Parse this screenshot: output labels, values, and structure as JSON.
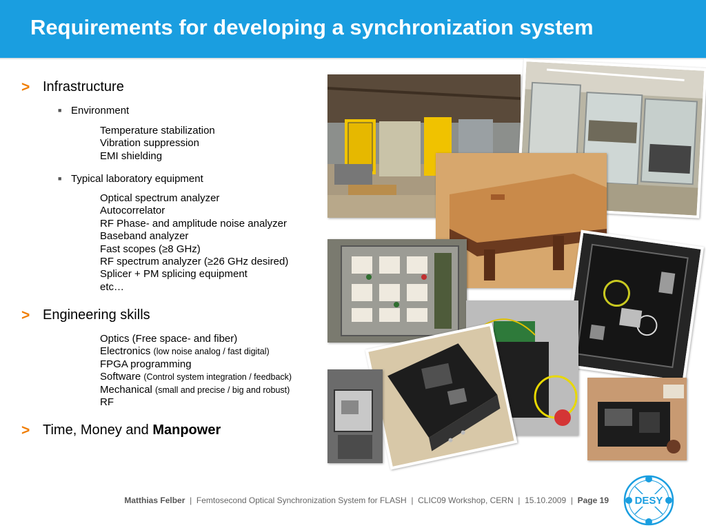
{
  "slide": {
    "title": "Requirements for developing a synchronization system"
  },
  "content": {
    "arrow_glyph": ">",
    "infrastructure": {
      "label": "Infrastructure",
      "environment": {
        "label": "Environment",
        "items": [
          "Temperature stabilization",
          "Vibration suppression",
          "EMI shielding"
        ]
      },
      "equipment": {
        "label": "Typical laboratory equipment",
        "items": [
          "Optical spectrum analyzer",
          "Autocorrelator",
          "RF Phase- and amplitude noise analyzer",
          "Baseband analyzer",
          "Fast scopes (≥8 GHz)",
          "RF spectrum analyzer (≥26 GHz desired)",
          "Splicer + PM splicing equipment",
          "etc…"
        ]
      }
    },
    "engineering": {
      "label": "Engineering skills",
      "items": [
        {
          "main": "Optics (Free space- and fiber)",
          "note": ""
        },
        {
          "main": "Electronics",
          "note": "(low noise analog / fast digital)"
        },
        {
          "main": "FPGA programming",
          "note": ""
        },
        {
          "main": "Software",
          "note": "(Control system integration / feedback)"
        },
        {
          "main": "Mechanical",
          "note": "(small and precise / big and robust)"
        },
        {
          "main": "RF",
          "note": ""
        }
      ]
    },
    "resources": {
      "label_prefix": "Time, Money and ",
      "label_bold": "Manpower"
    }
  },
  "footer": {
    "author": "Matthias Felber",
    "separator": "|",
    "talk_title": "Femtosecond Optical Synchronization System for FLASH",
    "event": "CLIC09 Workshop, CERN",
    "date": "15.10.2009",
    "page": "Page 19"
  },
  "logo": {
    "text": "DESY",
    "color": "#1a9ee0"
  },
  "colors": {
    "title_bar": "#1a9ee0",
    "arrow": "#f07d00"
  }
}
